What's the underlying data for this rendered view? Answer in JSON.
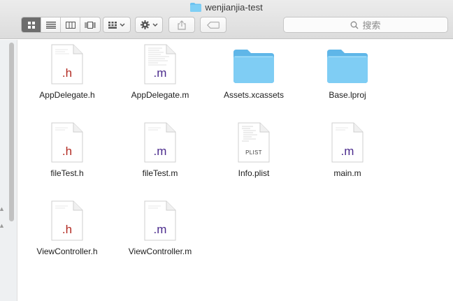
{
  "window": {
    "title": "wenjianjia-test"
  },
  "toolbar": {
    "view_modes": [
      "icon-view",
      "list-view",
      "column-view",
      "cover-flow-view"
    ],
    "active_view": "icon-view",
    "search_placeholder": "搜索"
  },
  "files": [
    {
      "name": "AppDelegate.h",
      "kind": "h",
      "ext": ".h"
    },
    {
      "name": "AppDelegate.m",
      "kind": "m",
      "ext": ".m"
    },
    {
      "name": "Assets.xcassets",
      "kind": "folder",
      "ext": ""
    },
    {
      "name": "Base.lproj",
      "kind": "folder",
      "ext": ""
    },
    {
      "name": "fileTest.h",
      "kind": "h",
      "ext": ".h"
    },
    {
      "name": "fileTest.m",
      "kind": "m",
      "ext": ".m"
    },
    {
      "name": "Info.plist",
      "kind": "plist",
      "ext": "PLIST"
    },
    {
      "name": "main.m",
      "kind": "m",
      "ext": ".m"
    },
    {
      "name": "ViewController.h",
      "kind": "h",
      "ext": ".h"
    },
    {
      "name": "ViewController.m",
      "kind": "m",
      "ext": ".m"
    }
  ],
  "colors": {
    "folder": "#6cc3f0",
    "h_ext": "#b22a22",
    "m_ext": "#4a2a8c"
  }
}
